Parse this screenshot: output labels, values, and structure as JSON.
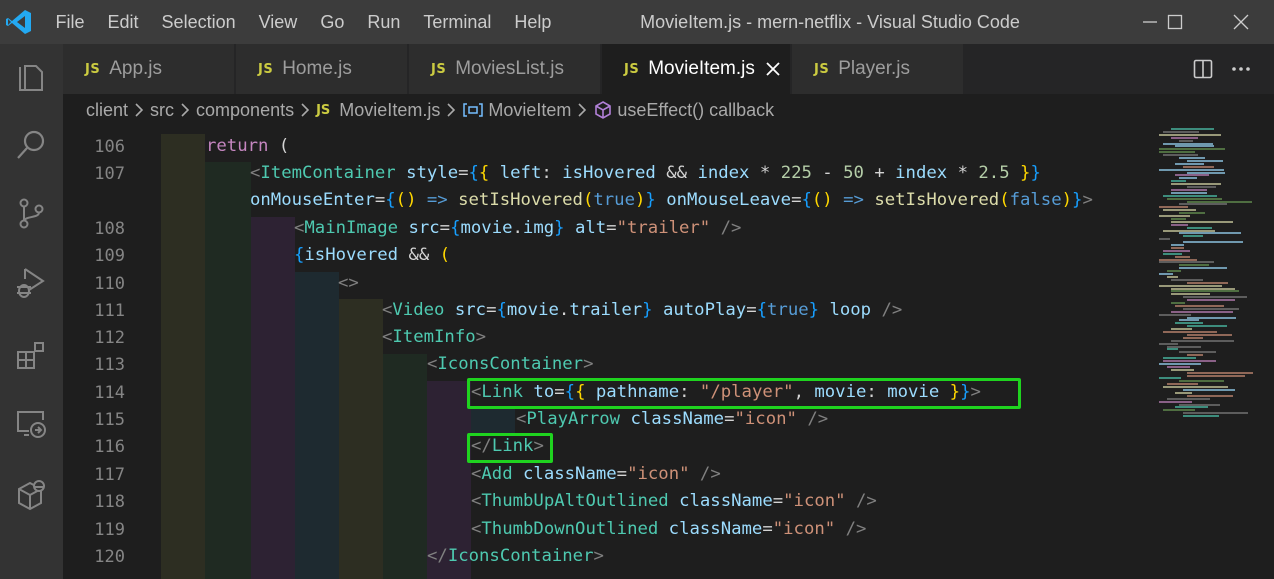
{
  "titlebar": {
    "menu": [
      "File",
      "Edit",
      "Selection",
      "View",
      "Go",
      "Run",
      "Terminal",
      "Help"
    ],
    "title": "MovieItem.js - mern-netflix - Visual Studio Code"
  },
  "tabs": [
    {
      "icon": "JS",
      "label": "App.js"
    },
    {
      "icon": "JS",
      "label": "Home.js"
    },
    {
      "icon": "JS",
      "label": "MoviesList.js"
    },
    {
      "icon": "JS",
      "label": "MovieItem.js",
      "active": true
    },
    {
      "icon": "JS",
      "label": "Player.js"
    }
  ],
  "breadcrumb": {
    "parts": [
      "client",
      "src",
      "components"
    ],
    "file_icon": "JS",
    "file": "MovieItem.js",
    "symbol": "MovieItem",
    "callback": "useEffect() callback"
  },
  "editor": {
    "line_numbers": [
      "106",
      "107",
      "",
      "108",
      "109",
      "110",
      "111",
      "112",
      "113",
      "114",
      "115",
      "116",
      "117",
      "118",
      "119",
      "120"
    ],
    "highlight_color": "#1fd31f"
  },
  "colors": {
    "titlebar": "#3c3c3c",
    "activitybar": "#333333",
    "editor_bg": "#1e1e1e",
    "tab_inactive": "#2d2d2d",
    "js_badge": "#cbcb41",
    "highlight_box": "#1fd31f"
  },
  "icons": {
    "activity": [
      "explorer-icon",
      "search-icon",
      "source-control-icon",
      "run-debug-icon",
      "extensions-icon",
      "remote-explorer-icon",
      "docker-icon"
    ]
  }
}
